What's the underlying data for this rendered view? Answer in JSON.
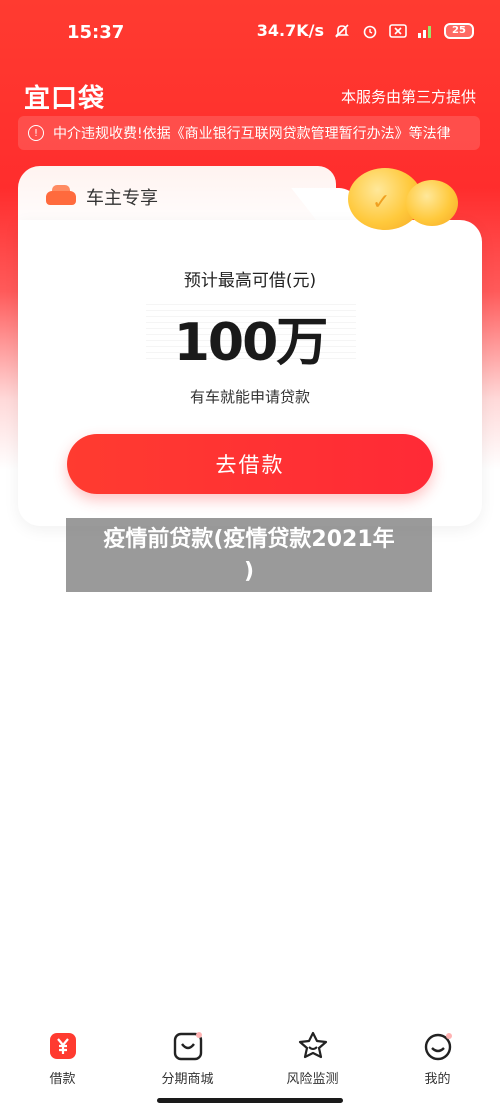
{
  "status_bar": {
    "time": "15:37",
    "network_speed": "34.7K/s",
    "battery": "25"
  },
  "header": {
    "logo": "宜口袋",
    "service_note": "本服务由第三方提供"
  },
  "notice": {
    "text": "中介违规收费!依据《商业银行互联网贷款管理暂行办法》等法律"
  },
  "card": {
    "tab_label": "车主专享",
    "amount_label": "预计最高可借(元)",
    "amount_value": "100万",
    "subtitle": "有车就能申请贷款",
    "button_label": "去借款"
  },
  "caption": {
    "line1": "疫情前贷款(疫情贷款2021年",
    "line2": ")"
  },
  "bottom_nav": {
    "items": [
      {
        "label": "借款",
        "icon": "yuan-icon",
        "active": true
      },
      {
        "label": "分期商城",
        "icon": "smile-bag-icon",
        "active": false
      },
      {
        "label": "风险监测",
        "icon": "star-shield-icon",
        "active": false
      },
      {
        "label": "我的",
        "icon": "profile-face-icon",
        "active": false
      }
    ]
  },
  "colors": {
    "brand_red": "#ff3b30",
    "coin_gold": "#ffc93c",
    "car_orange": "#ff6a3d"
  }
}
